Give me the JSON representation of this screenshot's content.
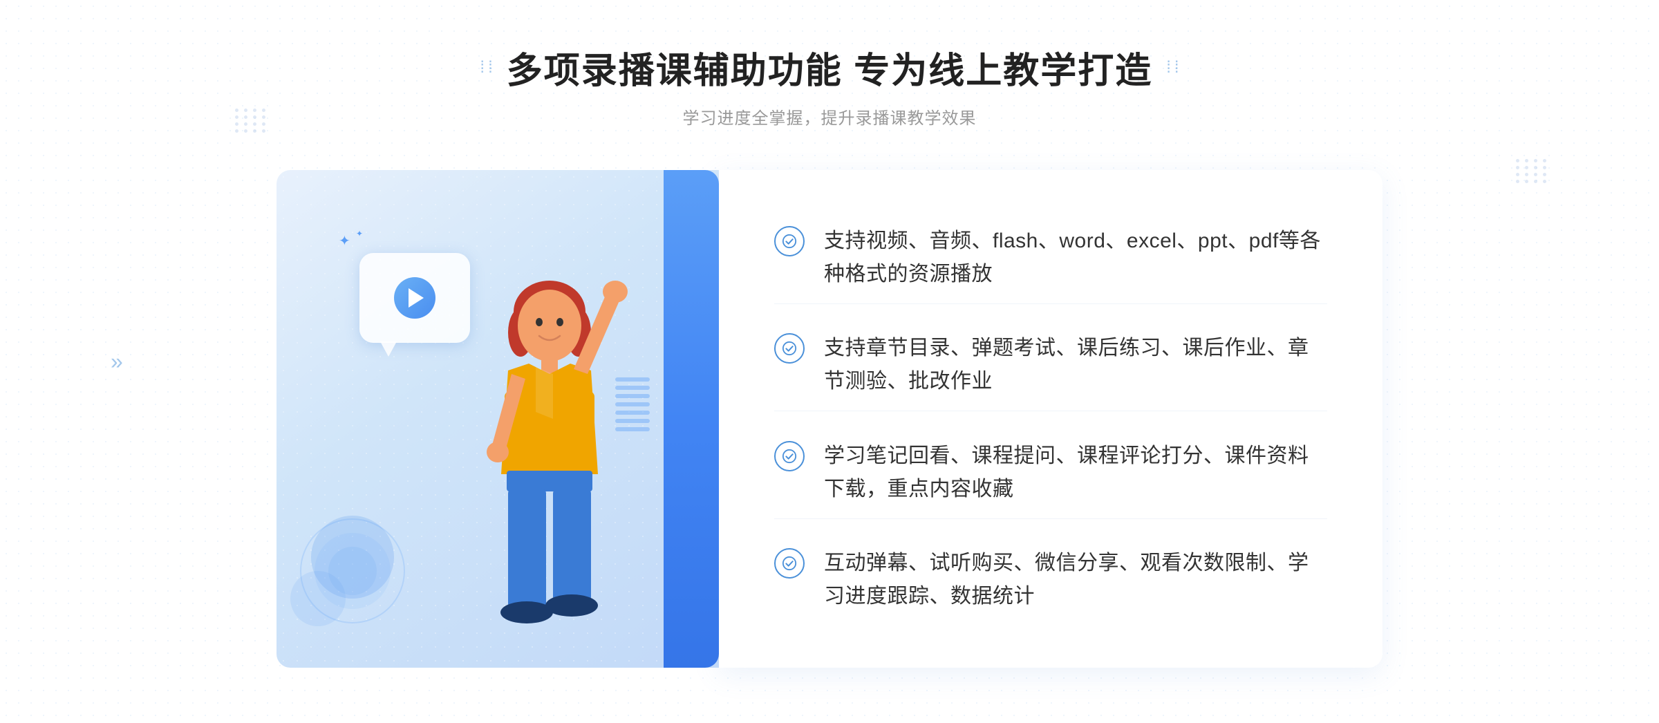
{
  "header": {
    "title": "多项录播课辅助功能 专为线上教学打造",
    "subtitle": "学习进度全掌握，提升录播课教学效果",
    "title_decorator_left": "⁞",
    "title_decorator_right": "⁞"
  },
  "features": [
    {
      "id": 1,
      "text": "支持视频、音频、flash、word、excel、ppt、pdf等各种格式的资源播放"
    },
    {
      "id": 2,
      "text": "支持章节目录、弹题考试、课后练习、课后作业、章节测验、批改作业"
    },
    {
      "id": 3,
      "text": "学习笔记回看、课程提问、课程评论打分、课件资料下载，重点内容收藏"
    },
    {
      "id": 4,
      "text": "互动弹幕、试听购买、微信分享、观看次数限制、学习进度跟踪、数据统计"
    }
  ],
  "colors": {
    "primary_blue": "#4a90d9",
    "title_color": "#222222",
    "subtitle_color": "#999999",
    "text_color": "#333333",
    "bg_light": "#f5f8fd",
    "illustration_bg": "#deeaf9"
  },
  "icons": {
    "check": "check-circle-icon",
    "play": "play-icon",
    "arrows_left": "»"
  }
}
